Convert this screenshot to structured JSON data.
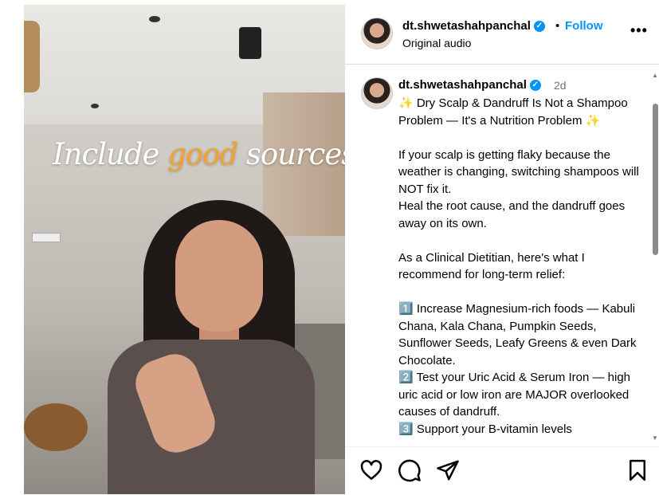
{
  "video": {
    "overlay_pre": "Include ",
    "overlay_highlight": "good",
    "overlay_post": " sources of"
  },
  "header": {
    "username": "dt.shwetashahpanchal",
    "dot": "•",
    "follow_label": "Follow",
    "audio": "Original audio",
    "more": "•••"
  },
  "post": {
    "username": "dt.shwetashahpanchal",
    "time": "2d",
    "caption": "✨ Dry Scalp & Dandruff Is Not a Shampoo Problem — It's a Nutrition Problem ✨\n\nIf your scalp is getting flaky because the weather is changing, switching shampoos will NOT fix it.\nHeal the root cause, and the dandruff goes away on its own.\n\nAs a Clinical Dietitian, here's what I recommend for long-term relief:\n\n1️⃣ Increase Magnesium-rich foods — Kabuli Chana, Kala Chana, Pumpkin Seeds, Sunflower Seeds, Leafy Greens & even Dark Chocolate.\n2️⃣ Test your Uric Acid & Serum Iron — high uric acid or low iron are MAJOR overlooked causes of dandruff.\n3️⃣ Support your B-vitamin levels"
  },
  "actions": {
    "like": "heart-icon",
    "comment": "comment-icon",
    "share": "share-icon",
    "save": "bookmark-icon"
  },
  "colors": {
    "accent": "#0095f6",
    "highlight": "#f3a232"
  }
}
